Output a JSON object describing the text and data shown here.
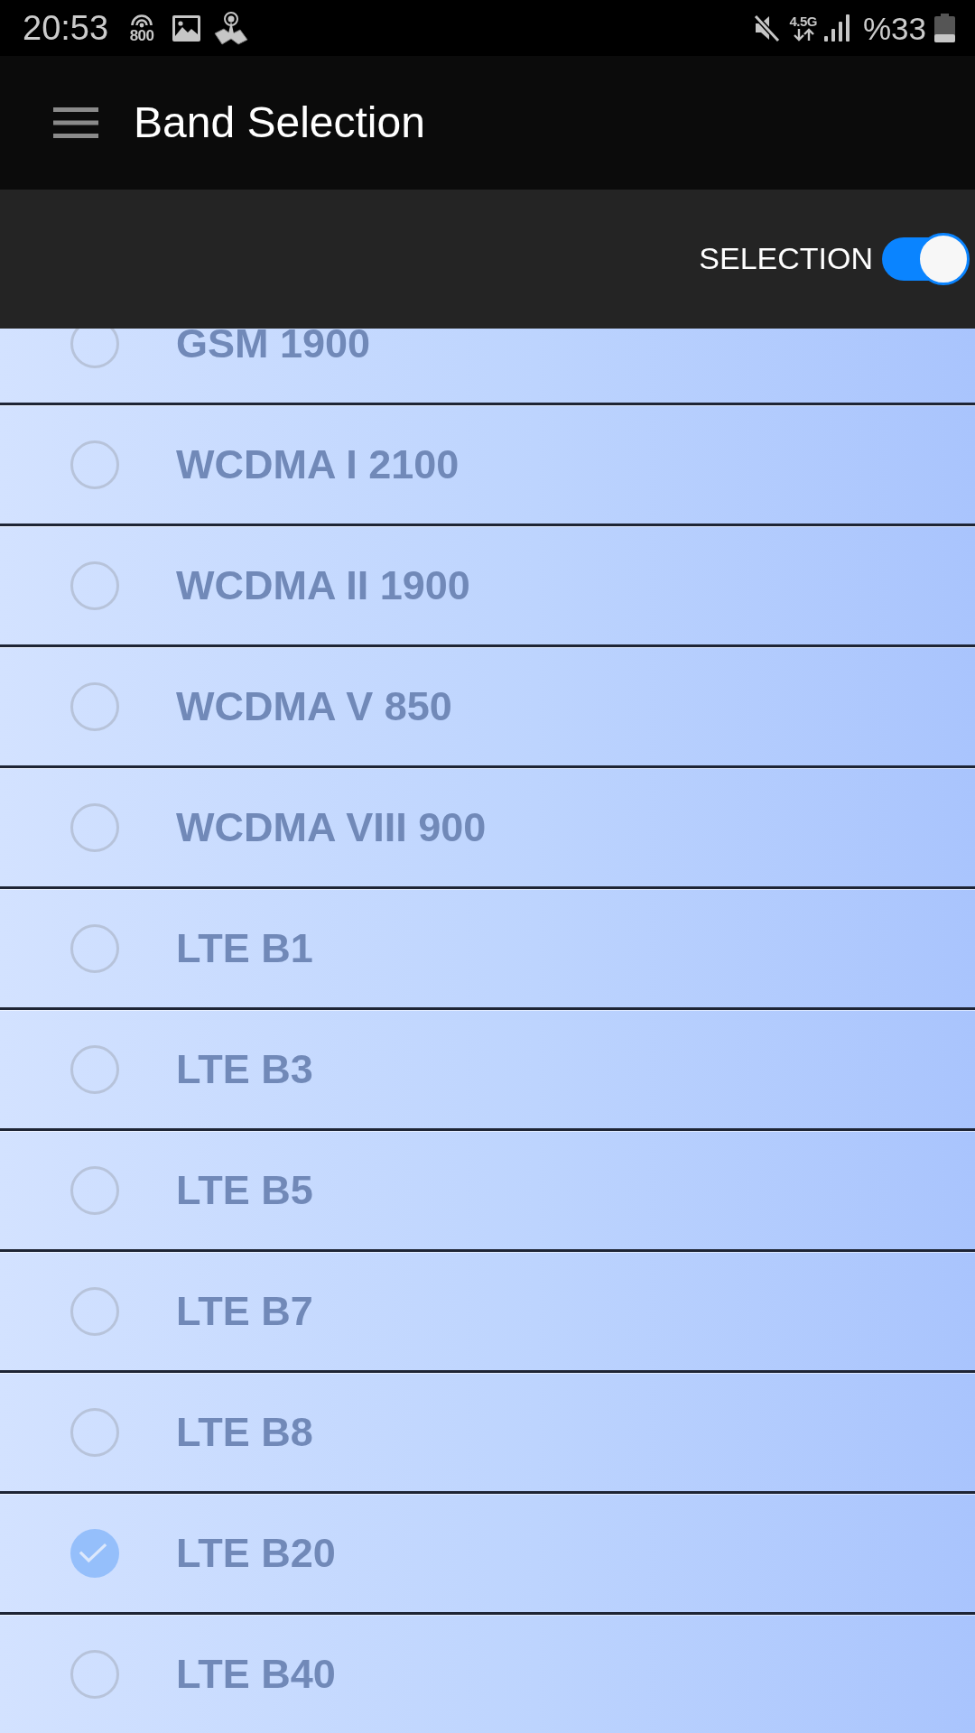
{
  "status_bar": {
    "time": "20:53",
    "broadcast_number": "800",
    "network_type": "4.5G",
    "battery_percent": "%33"
  },
  "app_bar": {
    "title": "Band Selection"
  },
  "toolbar": {
    "label": "SELECTION",
    "on": true
  },
  "bands": [
    {
      "label": "GSM 1900",
      "checked": false,
      "disabled": true
    },
    {
      "label": "WCDMA I 2100",
      "checked": false,
      "disabled": true
    },
    {
      "label": "WCDMA II 1900",
      "checked": false,
      "disabled": true
    },
    {
      "label": "WCDMA V 850",
      "checked": false,
      "disabled": true
    },
    {
      "label": "WCDMA VIII 900",
      "checked": false,
      "disabled": true
    },
    {
      "label": "LTE B1",
      "checked": false,
      "disabled": true
    },
    {
      "label": "LTE B3",
      "checked": false,
      "disabled": true
    },
    {
      "label": "LTE B5",
      "checked": false,
      "disabled": true
    },
    {
      "label": "LTE B7",
      "checked": false,
      "disabled": true
    },
    {
      "label": "LTE B8",
      "checked": false,
      "disabled": true
    },
    {
      "label": "LTE B20",
      "checked": true,
      "disabled": true
    },
    {
      "label": "LTE B40",
      "checked": false,
      "disabled": true
    }
  ]
}
